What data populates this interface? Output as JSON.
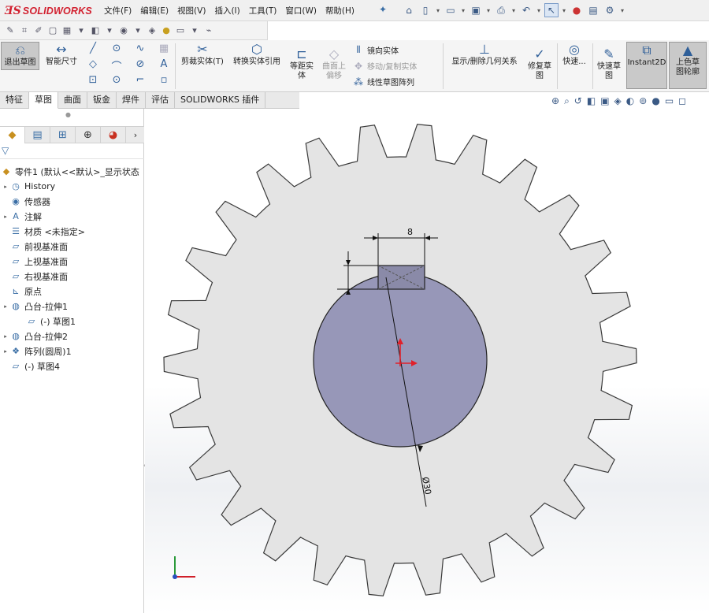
{
  "app": {
    "logo_mark": "ƎS",
    "logo_text": "SOLIDWORKS"
  },
  "menu": [
    "文件(F)",
    "编辑(E)",
    "视图(V)",
    "插入(I)",
    "工具(T)",
    "窗口(W)",
    "帮助(H)"
  ],
  "ribbon": {
    "exit_sketch": "退出草图",
    "smart_dim": "智能尺寸",
    "trim": "剪裁实体(T)",
    "convert": "转换实体引用",
    "offset": "等距实\n体",
    "surface_offset": "曲面上\n偏移",
    "mirror": "镜向实体",
    "move_copy": "移动/复制实体",
    "linear_pattern": "线性草图阵列",
    "show_relations": "显示/删除几何关系",
    "repair": "修复草\n图",
    "quick_snaps": "快速...",
    "rapid_sketch": "快速草\n图",
    "instant2d": "Instant2D",
    "shaded": "上色草\n图轮廓"
  },
  "tabs": [
    "特征",
    "草图",
    "曲面",
    "钣金",
    "焊件",
    "评估",
    "SOLIDWORKS 插件"
  ],
  "active_tab": 1,
  "tree": {
    "root": "零件1 (默认<<默认>_显示状态",
    "items": [
      {
        "label": "History",
        "icon": "history-icon",
        "level": 1,
        "expand": true
      },
      {
        "label": "传感器",
        "icon": "sensor-icon",
        "level": 1,
        "expand": false
      },
      {
        "label": "注解",
        "icon": "annotation-icon",
        "level": 1,
        "expand": true
      },
      {
        "label": "材质 <未指定>",
        "icon": "material-icon",
        "level": 1,
        "expand": false
      },
      {
        "label": "前视基准面",
        "icon": "plane-icon",
        "level": 1,
        "expand": false
      },
      {
        "label": "上视基准面",
        "icon": "plane-icon",
        "level": 1,
        "expand": false
      },
      {
        "label": "右视基准面",
        "icon": "plane-icon",
        "level": 1,
        "expand": false
      },
      {
        "label": "原点",
        "icon": "origin-icon",
        "level": 1,
        "expand": false
      },
      {
        "label": "凸台-拉伸1",
        "icon": "extrude-icon",
        "level": 1,
        "expand": true
      },
      {
        "label": "(-) 草图1",
        "icon": "sketch-icon",
        "level": 2,
        "expand": false
      },
      {
        "label": "凸台-拉伸2",
        "icon": "extrude-icon",
        "level": 1,
        "expand": true
      },
      {
        "label": "阵列(圆周)1",
        "icon": "pattern-icon",
        "level": 1,
        "expand": true
      },
      {
        "label": "(-) 草图4",
        "icon": "sketch-icon",
        "level": 1,
        "expand": false
      }
    ]
  },
  "sketch": {
    "gear_teeth": 26,
    "dim_width": "8",
    "dim_diameter": "Ø30",
    "colors": {
      "gear_fill": "#e4e4e4",
      "gear_stroke": "#3a3a3a",
      "hub_fill": "#9797b8",
      "origin": "#e0202a",
      "triad_z": "#2a9a3a",
      "triad_x": "#d0202a"
    }
  }
}
